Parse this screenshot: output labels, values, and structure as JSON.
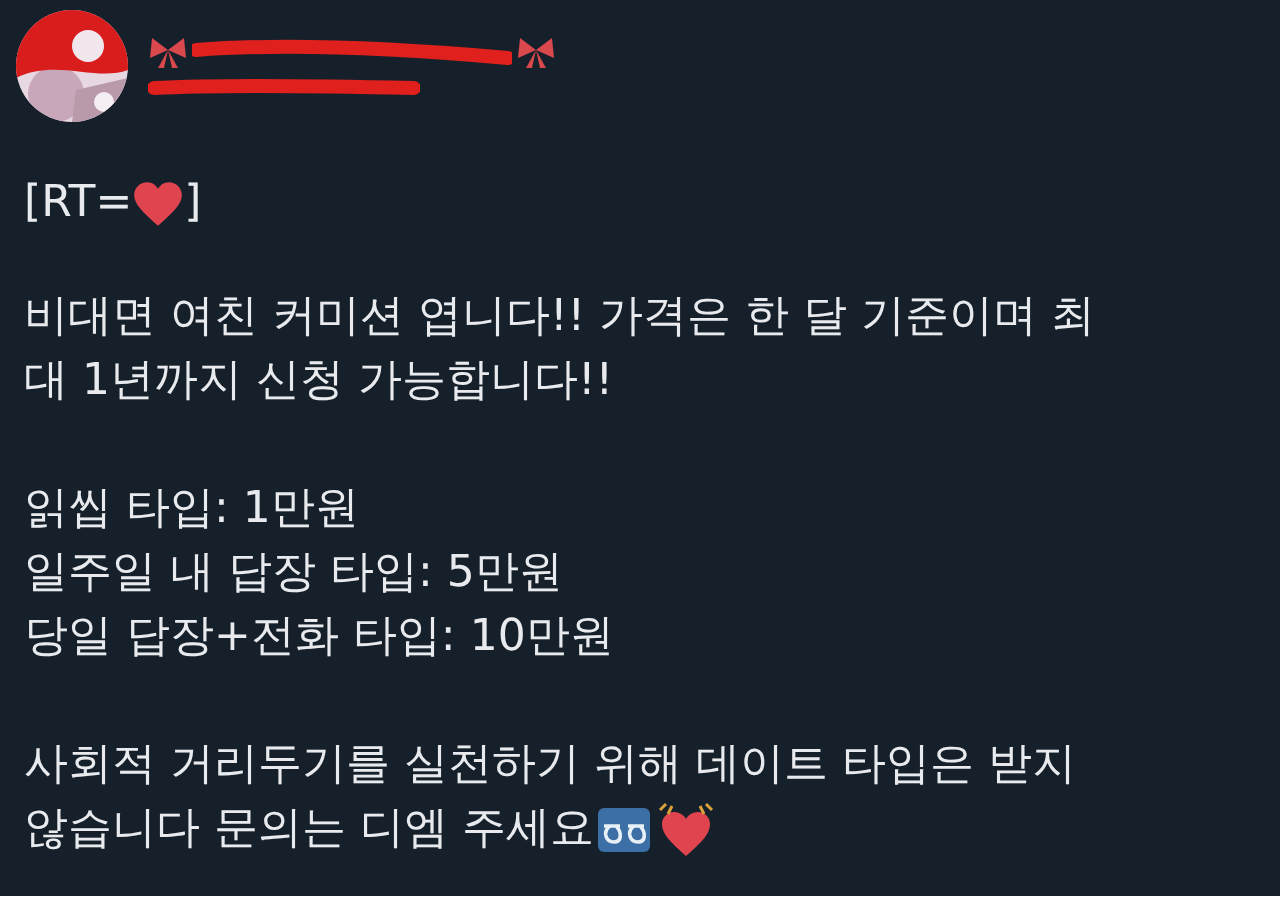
{
  "tweet": {
    "prefix": "[RT=",
    "suffix": "]",
    "paragraphs": [
      {
        "lines": [
          "비대면 여친 커미션 엽니다!! 가격은 한 달 기준이며 최",
          "대 1년까지 신청 가능합니다!!"
        ]
      },
      {
        "lines": [
          "읽씹 타입: 1만원",
          "일주일 내 답장 타입: 5만원",
          "당일 답장+전화 타입: 10만원"
        ]
      },
      {
        "lines": [
          "사회적 거리두기를 실천하기 위해 데이트 타입은 받지",
          "않습니다 문의는 디엠 주세요"
        ]
      }
    ]
  }
}
